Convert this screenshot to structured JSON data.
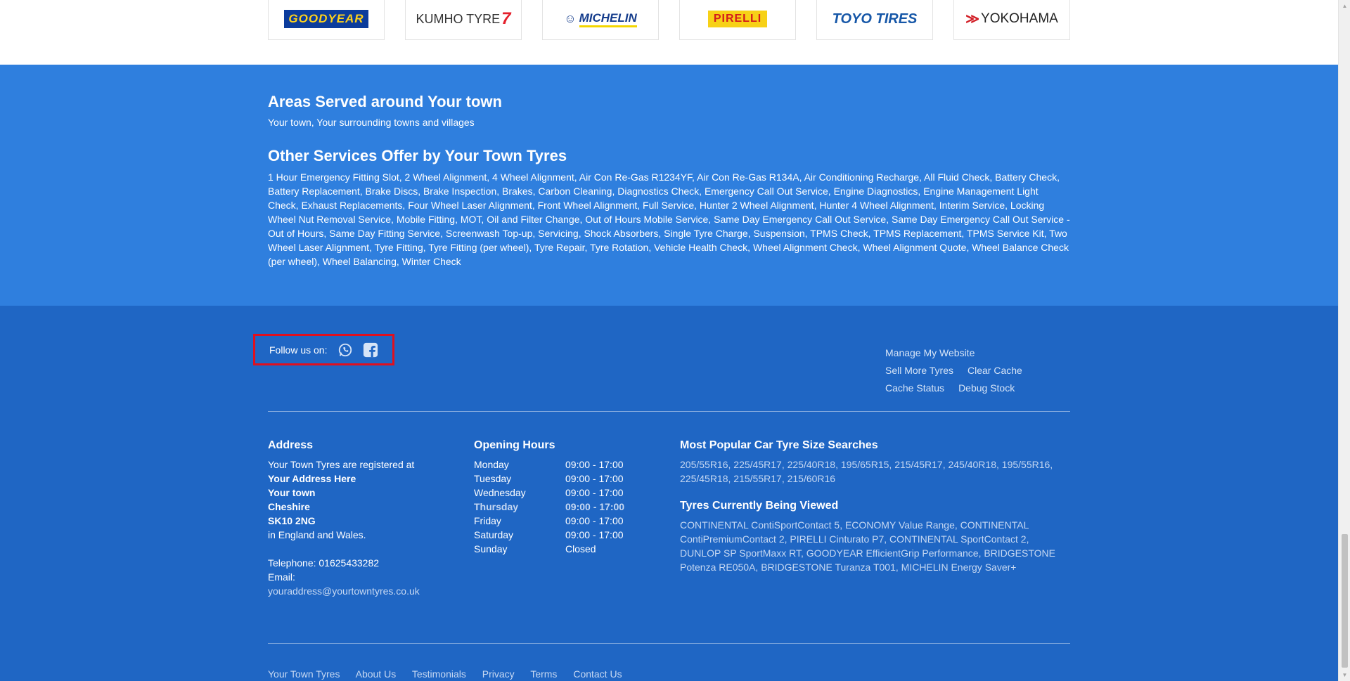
{
  "brands": {
    "goodyear": "GOODYEAR",
    "kumho": "KUMHO TYRE",
    "kumho_mark": "7",
    "michelin": "MICHELIN",
    "pirelli": "PIRELLI",
    "toyo": "TOYO TIRES",
    "yokohama": "YOKOHAMA"
  },
  "areas": {
    "title": "Areas Served around Your town",
    "text": "Your town, Your surrounding towns and villages"
  },
  "services": {
    "title": "Other Services Offer by Your Town Tyres",
    "text": "1 Hour Emergency Fitting Slot, 2 Wheel Alignment, 4 Wheel Alignment, Air Con Re-Gas R1234YF, Air Con Re-Gas R134A, Air Conditioning Recharge, All Fluid Check, Battery Check, Battery Replacement, Brake Discs, Brake Inspection, Brakes, Carbon Cleaning, Diagnostics Check, Emergency Call Out Service, Engine Diagnostics, Engine Management Light Check, Exhaust Replacements, Four Wheel Laser Alignment, Front Wheel Alignment, Full Service, Hunter 2 Wheel Alignment, Hunter 4 Wheel Alignment, Interim Service, Locking Wheel Nut Removal Service, Mobile Fitting, MOT, Oil and Filter Change, Out of Hours Mobile Service, Same Day Emergency Call Out Service, Same Day Emergency Call Out Service - Out of Hours, Same Day Fitting Service, Screenwash Top-up, Servicing, Shock Absorbers, Single Tyre Charge, Suspension, TPMS Check, TPMS Replacement, TPMS Service Kit, Two Wheel Laser Alignment, Tyre Fitting, Tyre Fitting (per wheel), Tyre Repair, Tyre Rotation, Vehicle Health Check, Wheel Alignment Check, Wheel Alignment Quote, Wheel Balance Check (per wheel), Wheel Balancing, Winter Check"
  },
  "follow": {
    "label": "Follow us on:",
    "icons": [
      "whatsapp-icon",
      "facebook-icon"
    ]
  },
  "manage": {
    "manage_website": "Manage My Website",
    "sell_more": "Sell More Tyres",
    "clear_cache": "Clear Cache",
    "cache_status": "Cache Status",
    "debug_stock": "Debug Stock"
  },
  "address": {
    "title": "Address",
    "intro": "Your Town Tyres are registered at",
    "line1": "Your Address Here",
    "line2": "Your town",
    "line3": "Cheshire",
    "postcode": "SK10 2NG",
    "country": "in England and Wales.",
    "telephone": "Telephone: 01625433282",
    "email_label": "Email:",
    "email": "youraddress@yourtowntyres.co.uk"
  },
  "hours": {
    "title": "Opening Hours",
    "days": [
      {
        "day": "Monday",
        "time": "09:00 - 17:00"
      },
      {
        "day": "Tuesday",
        "time": "09:00 - 17:00"
      },
      {
        "day": "Wednesday",
        "time": "09:00 - 17:00"
      },
      {
        "day": "Thursday",
        "time": "09:00 - 17:00"
      },
      {
        "day": "Friday",
        "time": "09:00 - 17:00"
      },
      {
        "day": "Saturday",
        "time": "09:00 - 17:00"
      },
      {
        "day": "Sunday",
        "time": "Closed"
      }
    ]
  },
  "popular": {
    "title": "Most Popular Car Tyre Size Searches",
    "sizes": [
      "205/55R16",
      "225/45R17",
      "225/40R18",
      "195/65R15",
      "215/45R17",
      "245/40R18",
      "195/55R16",
      "225/45R18",
      "215/55R17",
      "215/60R16"
    ]
  },
  "viewed": {
    "title": "Tyres Currently Being Viewed",
    "tyres": [
      "CONTINENTAL ContiSportContact 5",
      "ECONOMY Value Range",
      "CONTINENTAL ContiPremiumContact 2",
      "PIRELLI Cinturato P7",
      "CONTINENTAL SportContact 2",
      "DUNLOP SP SportMaxx RT",
      "GOODYEAR EfficientGrip Performance",
      "BRIDGESTONE Potenza RE050A",
      "BRIDGESTONE Turanza T001",
      "MICHELIN Energy Saver+"
    ]
  },
  "bottom_nav": {
    "home": "Your Town Tyres",
    "about": "About Us",
    "testimonials": "Testimonials",
    "privacy": "Privacy",
    "terms": "Terms",
    "contact": "Contact Us"
  },
  "colors": {
    "band": "#2f7fde",
    "footer": "#1f66c4",
    "highlight_border": "#e0101e"
  }
}
